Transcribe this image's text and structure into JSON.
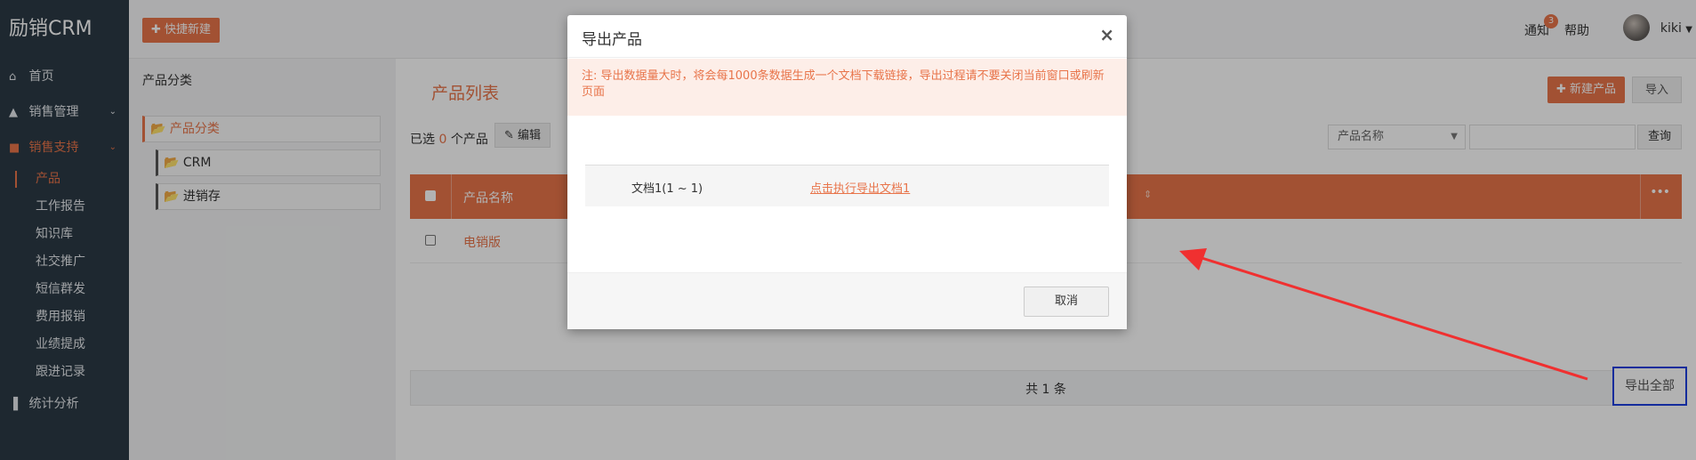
{
  "app": {
    "brand": "励销CRM"
  },
  "sidebar": {
    "items": [
      {
        "label": "首页",
        "icon": "home-icon"
      },
      {
        "label": "销售管理",
        "icon": "chart-area-icon",
        "expandable": true
      },
      {
        "label": "销售支持",
        "icon": "file-icon",
        "expandable": true,
        "active": true
      }
    ],
    "sub_items": [
      "产品",
      "工作报告",
      "知识库",
      "社交推广",
      "短信群发",
      "费用报销",
      "业绩提成",
      "跟进记录"
    ],
    "active_sub": "产品",
    "bottom_item": {
      "label": "统计分析",
      "icon": "bar-chart-icon"
    }
  },
  "topbar": {
    "quick_create": "快捷新建",
    "notify_label": "通知",
    "notify_count": "3",
    "help_label": "帮助",
    "user_name": "kiki"
  },
  "category_panel": {
    "title": "产品分类",
    "nodes": [
      "产品分类",
      "CRM",
      "进销存"
    ]
  },
  "main": {
    "title": "产品列表",
    "new_product": "新建产品",
    "import": "导入",
    "selected_prefix": "已选",
    "selected_count": "0",
    "selected_suffix": "个产品",
    "edit": "编辑",
    "search_field": "产品名称",
    "search_button": "查询",
    "table": {
      "column_name": "产品名称",
      "rows": [
        {
          "name": "电销版"
        }
      ]
    },
    "total_text": "共 1 条",
    "export_all": "导出全部"
  },
  "modal": {
    "title": "导出产品",
    "close": "×",
    "warning": "注: 导出数据量大时，将会每1000条数据生成一个文档下载链接，导出过程请不要关闭当前窗口或刷新页面",
    "documents": [
      {
        "name": "文档1(1 ~ 1)",
        "link": "点击执行导出文档1"
      }
    ],
    "cancel": "取消"
  },
  "colors": {
    "accent": "#e8744a",
    "sidebar_bg": "#2b3a45",
    "highlight_box": "#1e40e0",
    "annotation_arrow": "#f03030"
  }
}
